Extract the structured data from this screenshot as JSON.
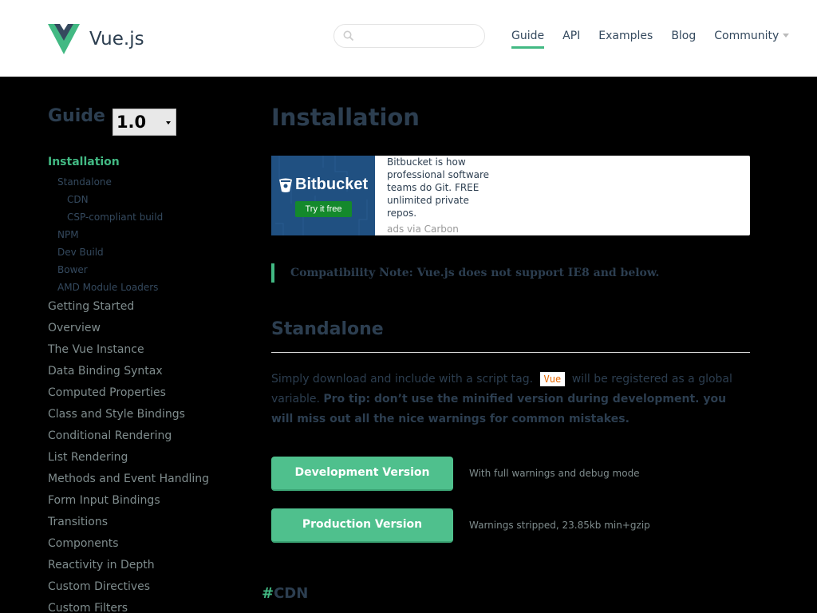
{
  "header": {
    "brand": "Vue.js",
    "search": {
      "placeholder": "",
      "value": ""
    },
    "nav": [
      {
        "label": "Guide",
        "active": true
      },
      {
        "label": "API"
      },
      {
        "label": "Examples"
      },
      {
        "label": "Blog"
      },
      {
        "label": "Community"
      }
    ]
  },
  "sidebar": {
    "title": "Guide",
    "version": "1.0",
    "active_item": "Installation",
    "sub_items": [
      "Standalone",
      "CDN",
      "CSP-compliant build",
      "NPM",
      "Dev Build",
      "Bower",
      "AMD Module Loaders"
    ],
    "items": [
      "Getting Started",
      "Overview",
      "The Vue Instance",
      "Data Binding Syntax",
      "Computed Properties",
      "Class and Style Bindings",
      "Conditional Rendering",
      "List Rendering",
      "Methods and Event Handling",
      "Form Input Bindings",
      "Transitions",
      "Components",
      "Reactivity in Depth",
      "Custom Directives",
      "Custom Filters"
    ]
  },
  "content": {
    "title": "Installation",
    "ad": {
      "logo_text": "Bitbucket",
      "button": "Try it free",
      "text": "Bitbucket is how professional software teams do Git. FREE unlimited private repos.",
      "via": "ads via Carbon"
    },
    "compat_note": "Compatibility Note: Vue.js does not support IE8 and below.",
    "standalone": {
      "heading": "Standalone",
      "text_before": "Simply download and include with a script tag.",
      "code": "Vue",
      "text_after": "will be registered as a global variable.",
      "pro_tip": "Pro tip: don’t use the minified version during development. you will miss out all the nice warnings for common mistakes."
    },
    "downloads": [
      {
        "label": "Development Version",
        "desc": "With full warnings and debug mode"
      },
      {
        "label": "Production Version",
        "desc": "Warnings stripped, 23.85kb min+gzip"
      }
    ],
    "cdn_hash": "#",
    "cdn_heading": "CDN"
  },
  "colors": {
    "accent": "#42b983",
    "button": "#4fc08d",
    "text_dark": "#2c3e50"
  }
}
